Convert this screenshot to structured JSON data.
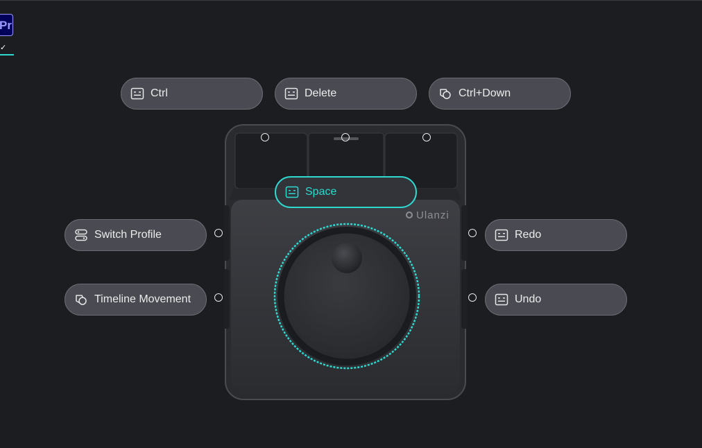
{
  "app_tab": {
    "badge": "Pr",
    "check": "✓"
  },
  "brand": "Ulanzi",
  "keys": {
    "top_left": {
      "label": "Ctrl",
      "icon": "key-icon"
    },
    "top_middle": {
      "label": "Delete",
      "icon": "key-icon"
    },
    "top_right": {
      "label": "Ctrl+Down",
      "icon": "multi-action-icon"
    },
    "front": {
      "label": "Space",
      "icon": "key-icon",
      "active": true
    },
    "left_upper": {
      "label": "Switch Profile",
      "icon": "profile-switch-icon"
    },
    "left_lower": {
      "label": "Timeline Movement",
      "icon": "multi-action-icon"
    },
    "right_upper": {
      "label": "Redo",
      "icon": "key-icon"
    },
    "right_lower": {
      "label": "Undo",
      "icon": "key-icon"
    }
  },
  "colors": {
    "accent": "#2ed9d0",
    "background": "#1c1d21",
    "pill": "#4a4b52"
  }
}
